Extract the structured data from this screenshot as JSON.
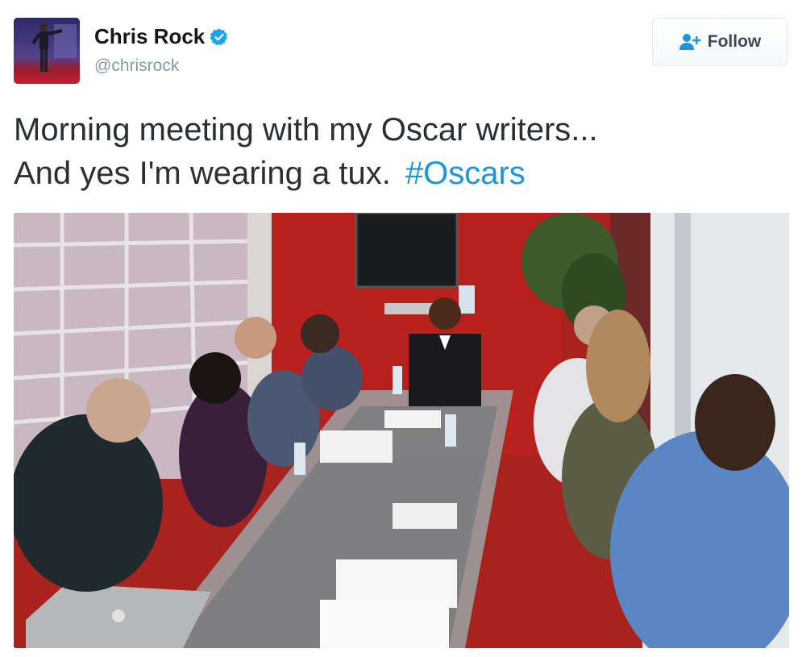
{
  "user": {
    "display_name": "Chris Rock",
    "handle": "@chrisrock",
    "verified": true,
    "avatar_icon": "profile-avatar"
  },
  "follow_button": {
    "label": "Follow",
    "icon": "add-user-icon"
  },
  "tweet": {
    "line1": "Morning meeting with my Oscar writers...",
    "line2": "And yes I'm wearing a tux.",
    "hashtag": "#Oscars"
  },
  "photo": {
    "laptop_logo": "apple-logo"
  },
  "colors": {
    "hashtag": "#1b95e0",
    "verified_badge": "#1da1f2",
    "follow_icon": "#1b95e0",
    "wall": "#b8201e"
  }
}
